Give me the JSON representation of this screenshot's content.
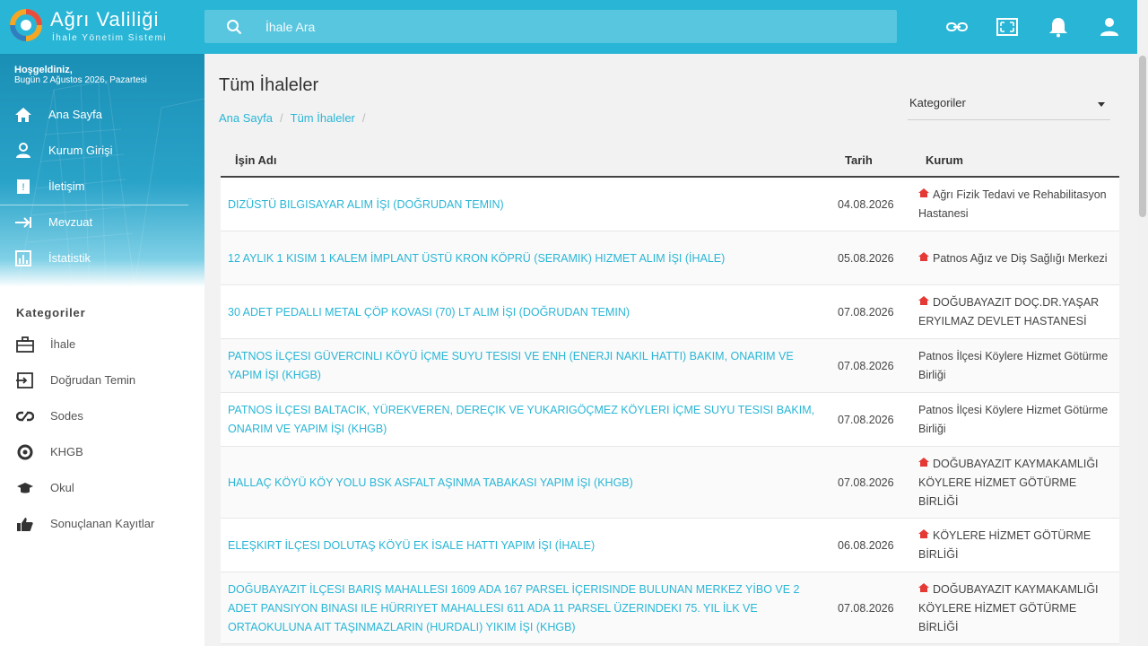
{
  "app": {
    "title": "Ağrı Valiliği",
    "subtitle": "İhale Yönetim Sistemi"
  },
  "search": {
    "placeholder": "İhale Ara"
  },
  "user": {
    "greeting": "Hoşgeldiniz,",
    "date_line": "Bugün 2 Ağustos 2026, Pazartesi"
  },
  "nav": [
    {
      "label": "Ana Sayfa",
      "icon": "home-icon"
    },
    {
      "label": "Kurum Girişi",
      "icon": "person-icon"
    },
    {
      "label": "İletişim",
      "icon": "contact-icon"
    },
    {
      "label": "Mevzuat",
      "icon": "arrow-right-icon"
    },
    {
      "label": "İstatistik",
      "icon": "chart-icon"
    }
  ],
  "categories": {
    "title": "Kategoriler",
    "items": [
      {
        "label": "İhale",
        "icon": "briefcase-icon"
      },
      {
        "label": "Doğrudan Temin",
        "icon": "direct-supply-icon"
      },
      {
        "label": "Sodes",
        "icon": "link-icon"
      },
      {
        "label": "KHGB",
        "icon": "circle-icon"
      },
      {
        "label": "Okul",
        "icon": "school-icon"
      },
      {
        "label": "Sonuçlanan Kayıtlar",
        "icon": "thumbs-up-icon"
      }
    ]
  },
  "main": {
    "title": "Tüm İhaleler",
    "breadcrumb": [
      "Ana Sayfa",
      "Tüm İhaleler"
    ],
    "category_select": "Kategoriler"
  },
  "table": {
    "headers": [
      "İşin Adı",
      "Tarih",
      "Kurum"
    ],
    "rows": [
      {
        "name": "Dizüstü Bilgisayar Alım İşi (Doğrudan Temin)",
        "date": "04.08.2026",
        "org": "Ağrı Fizik Tedavi ve Rehabilitasyon Hastanesi",
        "org_icon": true
      },
      {
        "name": "12 Aylık 1 Kısım 1 Kalem İmplant Üstü Kron Köprü (Seramik) Hizmet Alım İşi (İhale)",
        "date": "05.08.2026",
        "org": "Patnos Ağız ve Diş Sağlığı Merkezi",
        "org_icon": true
      },
      {
        "name": "30 Adet Pedallı Metal Çöp Kovası (70) Lt Alım İşi (Doğrudan Temin)",
        "date": "07.08.2026",
        "org": "DOĞUBAYAZIT DOÇ.DR.YAŞAR ERYILMAZ DEVLET HASTANESİ",
        "org_icon": true
      },
      {
        "name": "Patnos İlçesi Güvercinli Köyü İçme Suyu Tesisi ve ENH (Enerji Nakil Hattı) Bakım, Onarım ve Yapım İşi (KHGB)",
        "date": "07.08.2026",
        "org": "Patnos İlçesi Köylere Hizmet Götürme Birliği",
        "org_icon": false
      },
      {
        "name": "Patnos İlçesi Baltacık, Yürekveren, Dereçik ve Yukarıgöçmez Köyleri İçme Suyu Tesisi Bakım, Onarım ve Yapım İşi (KHGB)",
        "date": "07.08.2026",
        "org": "Patnos İlçesi Köylere Hizmet Götürme Birliği",
        "org_icon": false
      },
      {
        "name": "Hallaç Köyü Köy Yolu BSK Asfalt Aşınma Tabakası Yapım İşi (KHGB)",
        "date": "07.08.2026",
        "org": "DOĞUBAYAZIT KAYMAKAMLIĞI KÖYLERE HİZMET GÖTÜRME BİRLİĞİ",
        "org_icon": true
      },
      {
        "name": "Eleşkirt İlçesi Dolutaş Köyü Ek İsale Hattı Yapım İşi (İhale)",
        "date": "06.08.2026",
        "org": "KÖYLERE HİZMET GÖTÜRME BİRLİĞİ",
        "org_icon": true
      },
      {
        "name": "Doğubayazıt İlçesi Barış Mahallesi 1609 Ada 167 Parsel İçerisinde Bulunan Merkez YİBO ve 2 Adet Pansiyon Binası ile Hürriyet Mahallesi 611 Ada 11 Parsel Üzerindeki 75. Yıl İlk ve Ortaokuluna Ait Taşınmazların (Hurdalı) Yıkım İşi (KHGB)",
        "date": "07.08.2026",
        "org": "DOĞUBAYAZIT KAYMAKAMLIĞI KÖYLERE HİZMET GÖTÜRME BİRLİĞİ",
        "org_icon": true
      }
    ]
  },
  "colors": {
    "accent": "#29b6d6",
    "org_icon": "#e53935"
  }
}
